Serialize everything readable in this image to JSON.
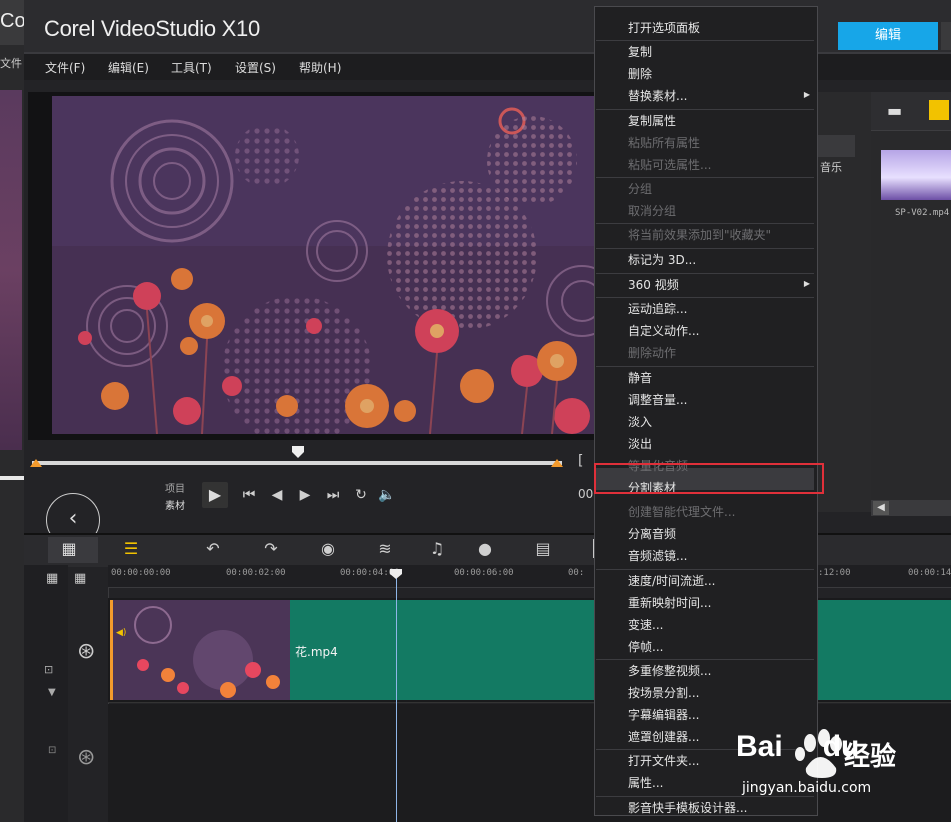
{
  "app": {
    "title": "Corel VideoStudio X10",
    "bg_title": "Co",
    "bg_menu": "文件"
  },
  "menubar": [
    {
      "label": "文件(F)"
    },
    {
      "label": "编辑(E)"
    },
    {
      "label": "工具(T)"
    },
    {
      "label": "设置(S)"
    },
    {
      "label": "帮助(H)"
    }
  ],
  "tabs": {
    "edit": "编辑"
  },
  "controls": {
    "project": "项目",
    "clip": "素材"
  },
  "library": {
    "music": "音乐",
    "thumb_label": "SP-V02.mp4"
  },
  "timeline": {
    "ticks": [
      "00:00:00:00",
      "00:00:02:00",
      "00:00:04:00",
      "00:00:06:00",
      "00:",
      ":12:00",
      "00:00:14:"
    ],
    "add_remove": "+/-",
    "clip_name": "花.mp4"
  },
  "context_menu": [
    {
      "label": "打开选项面板",
      "enabled": true
    },
    {
      "label": "复制",
      "enabled": true,
      "sep_before": true
    },
    {
      "label": "删除",
      "enabled": true
    },
    {
      "label": "替换素材...",
      "enabled": true,
      "submenu": true
    },
    {
      "label": "复制属性",
      "enabled": true,
      "sep_before": true
    },
    {
      "label": "粘贴所有属性",
      "enabled": false
    },
    {
      "label": "粘贴可选属性...",
      "enabled": false
    },
    {
      "label": "分组",
      "enabled": false,
      "sep_before": true
    },
    {
      "label": "取消分组",
      "enabled": false
    },
    {
      "label": "将当前效果添加到\"收藏夹\"",
      "enabled": false,
      "sep_before": true
    },
    {
      "label": "标记为 3D...",
      "enabled": true,
      "sep_before": true
    },
    {
      "label": "360 视频",
      "enabled": true,
      "submenu": true,
      "sep_before": true
    },
    {
      "label": "运动追踪...",
      "enabled": true,
      "sep_before": true
    },
    {
      "label": "自定义动作...",
      "enabled": true
    },
    {
      "label": "删除动作",
      "enabled": false
    },
    {
      "label": "静音",
      "enabled": true,
      "sep_before": true
    },
    {
      "label": "调整音量...",
      "enabled": true
    },
    {
      "label": "淡入",
      "enabled": true
    },
    {
      "label": "淡出",
      "enabled": true
    },
    {
      "label": "等量化音频",
      "enabled": false
    },
    {
      "label": "分割素材",
      "enabled": true,
      "highlighted": true
    },
    {
      "label": "创建智能代理文件...",
      "enabled": false
    },
    {
      "label": "分离音频",
      "enabled": true
    },
    {
      "label": "音频滤镜...",
      "enabled": true
    },
    {
      "label": "速度/时间流逝...",
      "enabled": true,
      "sep_before": true
    },
    {
      "label": "重新映射时间...",
      "enabled": true
    },
    {
      "label": "变速...",
      "enabled": true
    },
    {
      "label": "停帧...",
      "enabled": true
    },
    {
      "label": "多重修整视频...",
      "enabled": true,
      "sep_before": true
    },
    {
      "label": "按场景分割...",
      "enabled": true
    },
    {
      "label": "字幕编辑器...",
      "enabled": true
    },
    {
      "label": "遮罩创建器...",
      "enabled": true
    },
    {
      "label": "打开文件夹...",
      "enabled": true,
      "sep_before": true
    },
    {
      "label": "属性...",
      "enabled": true
    },
    {
      "label": "影音快手模板设计器...",
      "enabled": true,
      "sep_before": true
    }
  ],
  "watermark": {
    "brand": "Bai",
    "brand2": "du",
    "cn": "经验",
    "url": "jingyan.baidu.com"
  },
  "colors": {
    "accent": "#17a6e8",
    "clip": "#137a63",
    "highlight_box": "#e0303a",
    "trim_marker": "#f39a2c"
  }
}
